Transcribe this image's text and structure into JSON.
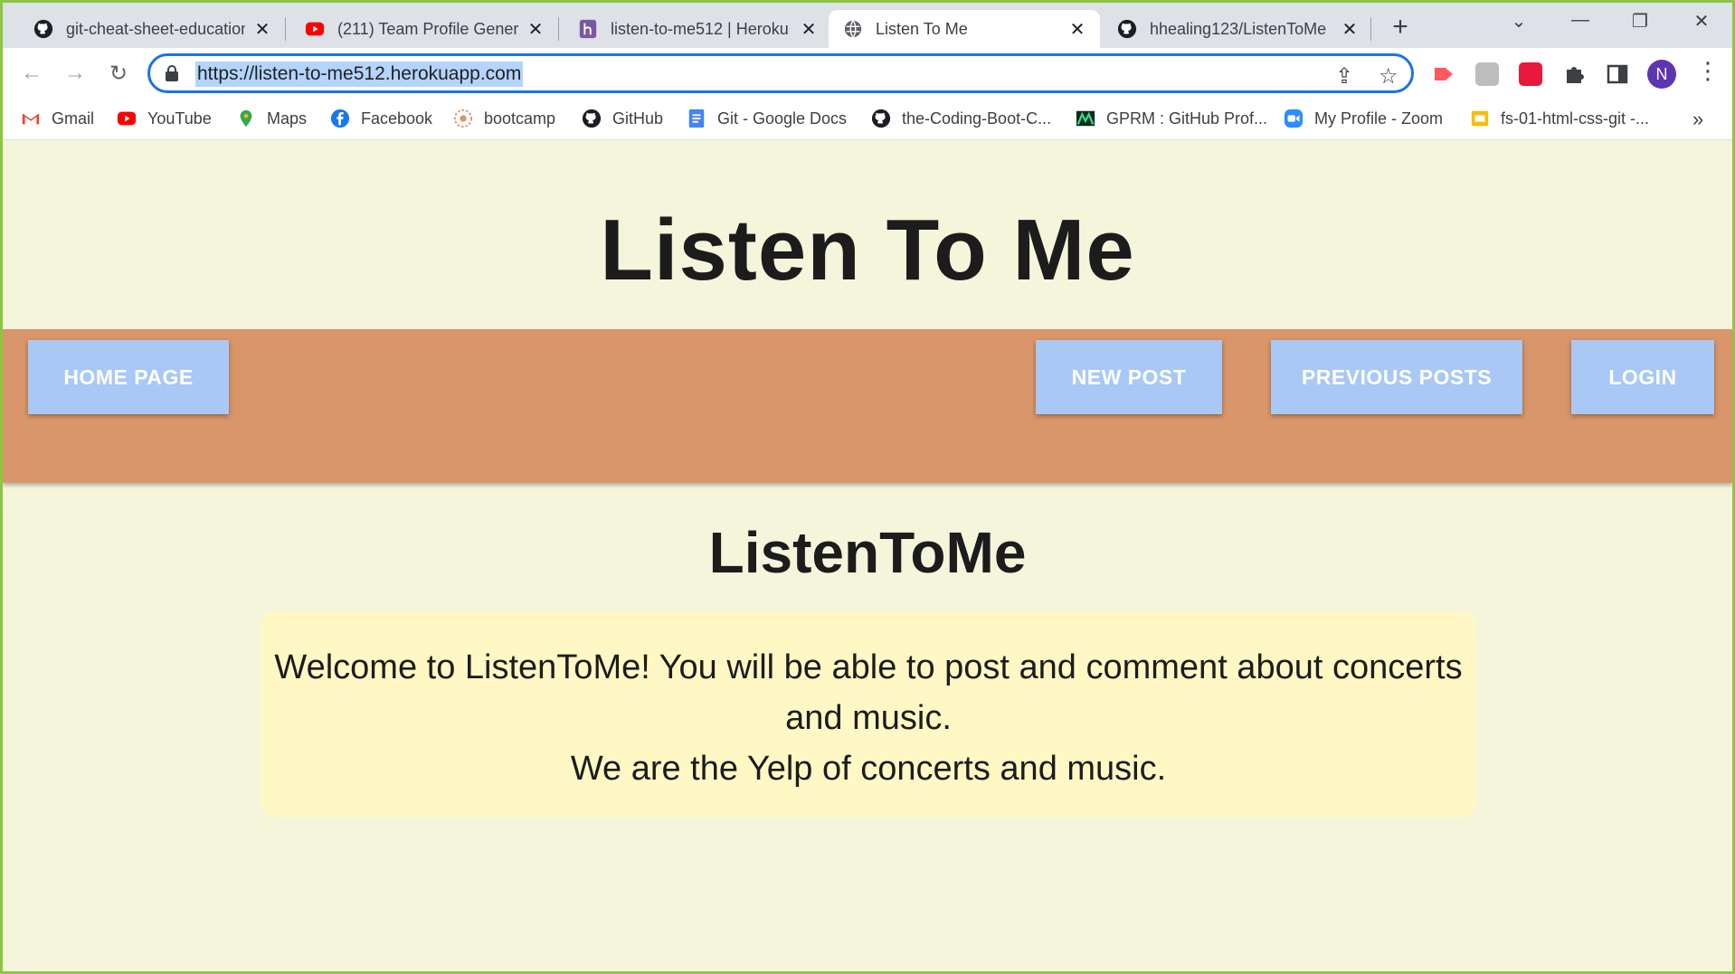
{
  "browser": {
    "tabs": [
      {
        "title": "git-cheat-sheet-education",
        "icon": "github-icon",
        "active": false
      },
      {
        "title": "(211) Team Profile Genera",
        "icon": "youtube-icon",
        "active": false
      },
      {
        "title": "listen-to-me512 | Heroku",
        "icon": "heroku-icon",
        "active": false
      },
      {
        "title": "Listen To Me",
        "icon": "globe-icon",
        "active": true
      },
      {
        "title": "hhealing123/ListenToMe",
        "icon": "github-icon",
        "active": false
      }
    ],
    "close_glyph": "✕",
    "new_tab_glyph": "+",
    "url": "https://listen-to-me512.herokuapp.com",
    "profile_initial": "N",
    "bookmarks": [
      {
        "label": "Gmail",
        "icon": "gmail-icon"
      },
      {
        "label": "YouTube",
        "icon": "youtube-icon"
      },
      {
        "label": "Maps",
        "icon": "maps-icon"
      },
      {
        "label": "Facebook",
        "icon": "facebook-icon"
      },
      {
        "label": "bootcamp",
        "icon": "bootcamp-icon"
      },
      {
        "label": "GitHub",
        "icon": "github-icon"
      },
      {
        "label": "Git - Google Docs",
        "icon": "google-docs-icon"
      },
      {
        "label": "the-Coding-Boot-C...",
        "icon": "github-icon"
      },
      {
        "label": "GPRM : GitHub Prof...",
        "icon": "gprm-icon"
      },
      {
        "label": "My Profile - Zoom",
        "icon": "zoom-icon"
      },
      {
        "label": "fs-01-html-css-git -...",
        "icon": "slides-icon"
      }
    ],
    "bookmarks_more": "»",
    "colors": {
      "accent": "#1a73e8",
      "frame_border": "#8dc63f"
    }
  },
  "site": {
    "title": "Listen To Me",
    "nav": {
      "home": "Home Page",
      "new_post": "New Post",
      "previous_posts": "Previous Posts",
      "login": "Login"
    },
    "heading": "ListenToMe",
    "welcome_line1": "Welcome to ListenToMe! You will be able to post and comment about concerts and music.",
    "welcome_line2": "We are the Yelp of concerts and music.",
    "colors": {
      "background": "#f5f5dc",
      "navbar": "#d9966a",
      "button": "#a9c8f5",
      "card": "#fff8c4"
    }
  }
}
